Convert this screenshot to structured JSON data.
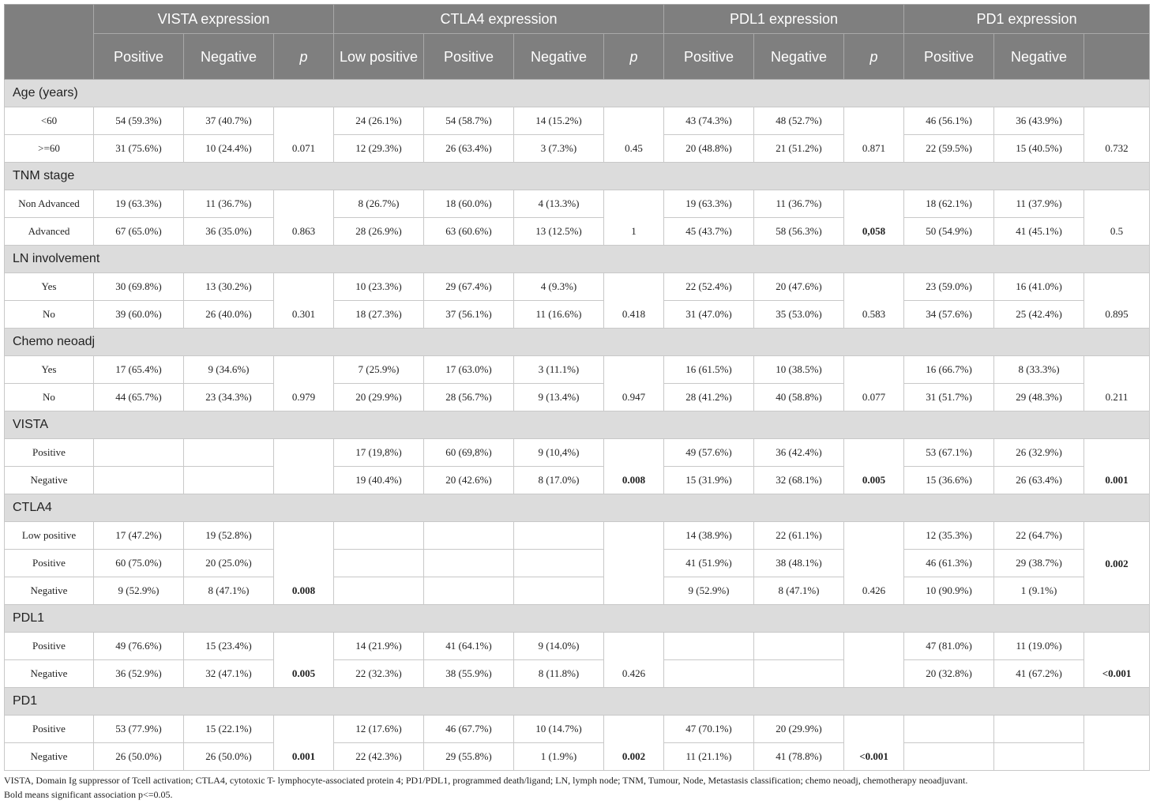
{
  "header": {
    "groups": [
      "VISTA expression",
      "CTLA4 expression",
      "PDL1 expression",
      "PD1 expression"
    ],
    "sub": {
      "vista": [
        "Positive",
        "Negative",
        "p"
      ],
      "ctla4": [
        "Low positive",
        "Positive",
        "Negative",
        "p"
      ],
      "pdl1": [
        "Positive",
        "Negative",
        "p"
      ],
      "pd1": [
        "Positive",
        "Negative",
        ""
      ]
    }
  },
  "sections": [
    {
      "title": "Age (years)",
      "rows": [
        {
          "label": "<60",
          "vista": [
            "54 (59.3%)",
            "37 (40.7%)"
          ],
          "ctla4": [
            "24 (26.1%)",
            "54 (58.7%)",
            "14 (15.2%)"
          ],
          "pdl1": [
            "43 (74.3%)",
            "48 (52.7%)"
          ],
          "pd1": [
            "46 (56.1%)",
            "36 (43.9%)"
          ]
        },
        {
          "label": ">=60",
          "vista": [
            "31 (75.6%)",
            "10 (24.4%)"
          ],
          "ctla4": [
            "12 (29.3%)",
            "26 (63.4%)",
            "3 (7.3%)"
          ],
          "pdl1": [
            "20 (48.8%)",
            "21 (51.2%)"
          ],
          "pd1": [
            "22 (59.5%)",
            "15 (40.5%)"
          ]
        }
      ],
      "p": {
        "vista": "0.071",
        "ctla4": "0.45",
        "pdl1": "0.871",
        "pd1": "0.732"
      },
      "bold": {
        "vista": false,
        "ctla4": false,
        "pdl1": false,
        "pd1": false
      }
    },
    {
      "title": "TNM stage",
      "rows": [
        {
          "label": "Non Advanced",
          "vista": [
            "19 (63.3%)",
            "11 (36.7%)"
          ],
          "ctla4": [
            "8 (26.7%)",
            "18 (60.0%)",
            "4 (13.3%)"
          ],
          "pdl1": [
            "19 (63.3%)",
            "11 (36.7%)"
          ],
          "pd1": [
            "18 (62.1%)",
            "11 (37.9%)"
          ]
        },
        {
          "label": "Advanced",
          "vista": [
            "67 (65.0%)",
            "36 (35.0%)"
          ],
          "ctla4": [
            "28 (26.9%)",
            "63 (60.6%)",
            "13 (12.5%)"
          ],
          "pdl1": [
            "45 (43.7%)",
            "58 (56.3%)"
          ],
          "pd1": [
            "50 (54.9%)",
            "41 (45.1%)"
          ]
        }
      ],
      "p": {
        "vista": "0.863",
        "ctla4": "1",
        "pdl1": "0,058",
        "pd1": "0.5"
      },
      "bold": {
        "vista": false,
        "ctla4": false,
        "pdl1": true,
        "pd1": false
      }
    },
    {
      "title": "LN involvement",
      "rows": [
        {
          "label": "Yes",
          "vista": [
            "30 (69.8%)",
            "13 (30.2%)"
          ],
          "ctla4": [
            "10 (23.3%)",
            "29 (67.4%)",
            "4 (9.3%)"
          ],
          "pdl1": [
            "22 (52.4%)",
            "20 (47.6%)"
          ],
          "pd1": [
            "23 (59.0%)",
            "16 (41.0%)"
          ]
        },
        {
          "label": "No",
          "vista": [
            "39 (60.0%)",
            "26 (40.0%)"
          ],
          "ctla4": [
            "18 (27.3%)",
            "37 (56.1%)",
            "11 (16.6%)"
          ],
          "pdl1": [
            "31 (47.0%)",
            "35 (53.0%)"
          ],
          "pd1": [
            "34 (57.6%)",
            "25 (42.4%)"
          ]
        }
      ],
      "p": {
        "vista": "0.301",
        "ctla4": "0.418",
        "pdl1": "0.583",
        "pd1": "0.895"
      },
      "bold": {
        "vista": false,
        "ctla4": false,
        "pdl1": false,
        "pd1": false
      }
    },
    {
      "title": "Chemo neoadj",
      "rows": [
        {
          "label": "Yes",
          "vista": [
            "17 (65.4%)",
            "9 (34.6%)"
          ],
          "ctla4": [
            "7 (25.9%)",
            "17 (63.0%)",
            "3 (11.1%)"
          ],
          "pdl1": [
            "16 (61.5%)",
            "10 (38.5%)"
          ],
          "pd1": [
            "16 (66.7%)",
            "8 (33.3%)"
          ]
        },
        {
          "label": "No",
          "vista": [
            "44 (65.7%)",
            "23 (34.3%)"
          ],
          "ctla4": [
            "20 (29.9%)",
            "28 (56.7%)",
            "9 (13.4%)"
          ],
          "pdl1": [
            "28 (41.2%)",
            "40 (58.8%)"
          ],
          "pd1": [
            "31 (51.7%)",
            "29 (48.3%)"
          ]
        }
      ],
      "p": {
        "vista": "0.979",
        "ctla4": "0.947",
        "pdl1": "0.077",
        "pd1": "0.211"
      },
      "bold": {
        "vista": false,
        "ctla4": false,
        "pdl1": false,
        "pd1": false
      }
    },
    {
      "title": "VISTA",
      "rows": [
        {
          "label": "Positive",
          "vista": [
            "",
            ""
          ],
          "ctla4": [
            "17 (19,8%)",
            "60 (69,8%)",
            "9 (10,4%)"
          ],
          "pdl1": [
            "49 (57.6%)",
            "36 (42.4%)"
          ],
          "pd1": [
            "53 (67.1%)",
            "26 (32.9%)"
          ]
        },
        {
          "label": "Negative",
          "vista": [
            "",
            ""
          ],
          "ctla4": [
            "19 (40.4%)",
            "20 (42.6%)",
            "8 (17.0%)"
          ],
          "pdl1": [
            "15 (31.9%)",
            "32 (68.1%)"
          ],
          "pd1": [
            "15 (36.6%)",
            "26 (63.4%)"
          ]
        }
      ],
      "p": {
        "vista": "",
        "ctla4": "0.008",
        "pdl1": "0.005",
        "pd1": "0.001"
      },
      "bold": {
        "vista": false,
        "ctla4": true,
        "pdl1": true,
        "pd1": true
      }
    },
    {
      "title": "CTLA4",
      "rows": [
        {
          "label": "Low positive",
          "vista": [
            "17 (47.2%)",
            "19 (52.8%)"
          ],
          "ctla4": [
            "",
            "",
            ""
          ],
          "pdl1": [
            "14 (38.9%)",
            "22 (61.1%)"
          ],
          "pd1": [
            "12 (35.3%)",
            "22 (64.7%)"
          ]
        },
        {
          "label": "Positive",
          "vista": [
            "60 (75.0%)",
            "20 (25.0%)"
          ],
          "ctla4": [
            "",
            "",
            ""
          ],
          "pdl1": [
            "41 (51.9%)",
            "38 (48.1%)"
          ],
          "pd1": [
            "46 (61.3%)",
            "29 (38.7%)"
          ]
        },
        {
          "label": "Negative",
          "vista": [
            "9 (52.9%)",
            "8 (47.1%)"
          ],
          "ctla4": [
            "",
            "",
            ""
          ],
          "pdl1": [
            "9 (52.9%)",
            "8 (47.1%)"
          ],
          "pd1": [
            "10 (90.9%)",
            "1 (9.1%)"
          ]
        }
      ],
      "p": {
        "vista": "0.008",
        "ctla4": "",
        "pdl1": "0.426",
        "pd1": "0.002"
      },
      "bold": {
        "vista": true,
        "ctla4": false,
        "pdl1": false,
        "pd1": true
      },
      "mid": {
        "pd1": true
      }
    },
    {
      "title": "PDL1",
      "rows": [
        {
          "label": "Positive",
          "vista": [
            "49 (76.6%)",
            "15 (23.4%)"
          ],
          "ctla4": [
            "14 (21.9%)",
            "41 (64.1%)",
            "9 (14.0%)"
          ],
          "pdl1": [
            "",
            ""
          ],
          "pd1": [
            "47 (81.0%)",
            "11 (19.0%)"
          ]
        },
        {
          "label": "Negative",
          "vista": [
            "36 (52.9%)",
            "32 (47.1%)"
          ],
          "ctla4": [
            "22 (32.3%)",
            "38 (55.9%)",
            "8 (11.8%)"
          ],
          "pdl1": [
            "",
            ""
          ],
          "pd1": [
            "20 (32.8%)",
            "41 (67.2%)"
          ]
        }
      ],
      "p": {
        "vista": "0.005",
        "ctla4": "0.426",
        "pdl1": "",
        "pd1": "<0.001"
      },
      "bold": {
        "vista": true,
        "ctla4": false,
        "pdl1": false,
        "pd1": true
      }
    },
    {
      "title": "PD1",
      "rows": [
        {
          "label": "Positive",
          "vista": [
            "53 (77.9%)",
            "15 (22.1%)"
          ],
          "ctla4": [
            "12 (17.6%)",
            "46 (67.7%)",
            "10 (14.7%)"
          ],
          "pdl1": [
            "47 (70.1%)",
            "20 (29.9%)"
          ],
          "pd1": [
            "",
            ""
          ]
        },
        {
          "label": "Negative",
          "vista": [
            "26 (50.0%)",
            "26 (50.0%)"
          ],
          "ctla4": [
            "22 (42.3%)",
            "29 (55.8%)",
            "1 (1.9%)"
          ],
          "pdl1": [
            "11 (21.1%)",
            "41 (78.8%)"
          ],
          "pd1": [
            "",
            ""
          ]
        }
      ],
      "p": {
        "vista": "0.001",
        "ctla4": "0.002",
        "pdl1": "<0.001",
        "pd1": ""
      },
      "bold": {
        "vista": true,
        "ctla4": true,
        "pdl1": true,
        "pd1": false
      }
    }
  ],
  "footnote": {
    "line1": "VISTA, Domain Ig suppressor of Tcell activation; CTLA4, cytotoxic T- lymphocyte-associated protein 4; PD1/PDL1, programmed death/ligand; LN, lymph node; TNM, Tumour, Node, Metastasis classification; chemo neoadj, chemotherapy neoadjuvant.",
    "line2": "Bold means significant association p<=0.05."
  }
}
